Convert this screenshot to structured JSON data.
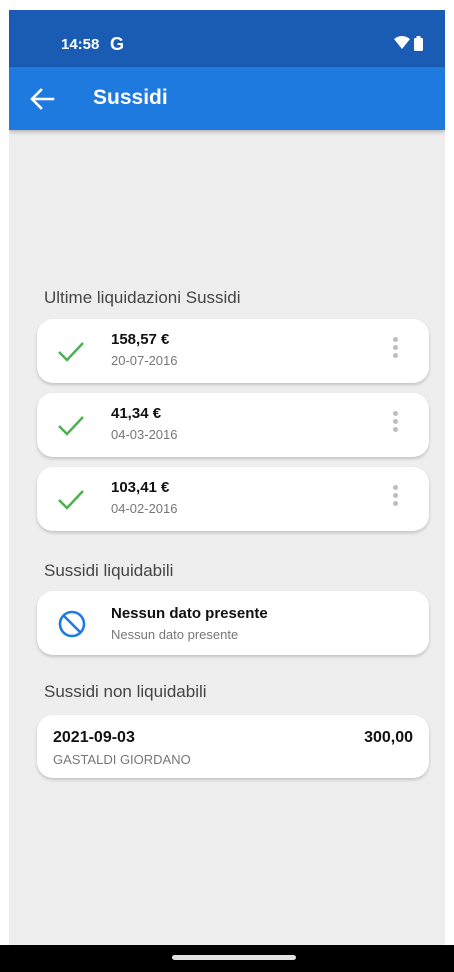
{
  "status_bar": {
    "time": "14:58",
    "g_logo": "G",
    "icons": [
      "wifi-icon",
      "battery-icon"
    ]
  },
  "app_bar": {
    "title": "Sussidi",
    "back_icon": "arrow-left-icon"
  },
  "sections": {
    "ultime": {
      "title": "Ultime liquidazioni Sussidi",
      "items": [
        {
          "amount": "158,57 €",
          "date": "20-07-2016"
        },
        {
          "amount": "41,34 €",
          "date": "04-03-2016"
        },
        {
          "amount": "103,41 €",
          "date": "04-02-2016"
        }
      ]
    },
    "liquidabili": {
      "title": "Sussidi liquidabili",
      "empty_title": "Nessun dato presente",
      "empty_subtitle": "Nessun dato presente"
    },
    "non_liquidabili": {
      "title": "Sussidi non liquidabili",
      "items": [
        {
          "date": "2021-09-03",
          "name": "GASTALDI GIORDANO",
          "amount": "300,00"
        }
      ]
    }
  },
  "colors": {
    "status_bar": "#1a5cb3",
    "app_bar": "#1f7ae0",
    "background": "#eeeeee",
    "check": "#4caf50",
    "ban": "#1f7ae0"
  }
}
